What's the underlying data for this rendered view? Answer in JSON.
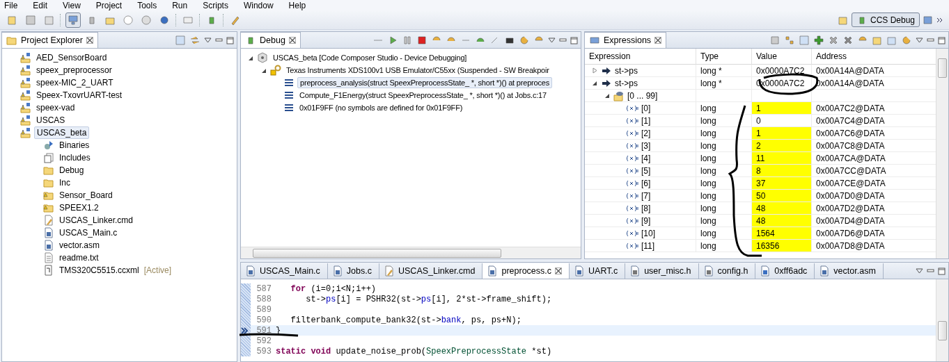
{
  "menu": [
    "File",
    "Edit",
    "View",
    "Project",
    "Tools",
    "Run",
    "Scripts",
    "Window",
    "Help"
  ],
  "perspective": {
    "label": "CCS Debug",
    "selected": true
  },
  "project_explorer": {
    "title": "Project Explorer",
    "items": [
      {
        "label": "AED_SensorBoard",
        "kind": "project",
        "selected": false
      },
      {
        "label": "speex_preprocessor",
        "kind": "project",
        "selected": false
      },
      {
        "label": "speex-MIC_2_UART",
        "kind": "project",
        "selected": false
      },
      {
        "label": "Speex-TxovrUART-test",
        "kind": "project",
        "selected": false
      },
      {
        "label": "speex-vad",
        "kind": "project",
        "selected": false
      },
      {
        "label": "USCAS",
        "kind": "project",
        "selected": false
      },
      {
        "label": "USCAS_beta",
        "kind": "project",
        "selected": true,
        "children": [
          {
            "label": "Binaries",
            "kind": "binaries",
            "selected": false
          },
          {
            "label": "Includes",
            "kind": "includes",
            "selected": false
          },
          {
            "label": "Debug",
            "kind": "folder",
            "selected": false
          },
          {
            "label": "Inc",
            "kind": "folder",
            "selected": false
          },
          {
            "label": "Sensor_Board",
            "kind": "folder-warning",
            "selected": false
          },
          {
            "label": "SPEEX1.2",
            "kind": "folder-warning",
            "selected": false
          },
          {
            "label": "USCAS_Linker.cmd",
            "kind": "linker",
            "selected": false
          },
          {
            "label": "USCAS_Main.c",
            "kind": "c-file",
            "selected": false
          },
          {
            "label": "vector.asm",
            "kind": "asm-file",
            "selected": false
          },
          {
            "label": "readme.txt",
            "kind": "text-file",
            "selected": false
          },
          {
            "label": "TMS320C5515.ccxml",
            "suffix": "[Active]",
            "kind": "ccxml",
            "selected": false
          }
        ]
      }
    ]
  },
  "debug": {
    "title": "Debug",
    "items": [
      {
        "label": "USCAS_beta [Code Composer Studio - Device Debugging]",
        "kind": "session",
        "expanded": true,
        "selected": false,
        "children": [
          {
            "label": "Texas Instruments XDS100v1 USB Emulator/C55xx (Suspended - SW Breakpoir",
            "kind": "target",
            "expanded": true,
            "selected": false,
            "children": [
              {
                "label": "preprocess_analysis(struct SpeexPreprocessState_ *, short *)() at preproces",
                "kind": "frame",
                "selected": true
              },
              {
                "label": "Compute_F1Energy(struct SpeexPreprocessState_ *, short *)() at Jobs.c:17",
                "kind": "frame",
                "selected": false
              },
              {
                "label": "0x01F9FF  (no symbols are defined for 0x01F9FF)",
                "kind": "frame",
                "selected": false
              }
            ]
          }
        ]
      }
    ]
  },
  "expressions": {
    "title": "Expressions",
    "columns": [
      "Expression",
      "Type",
      "Value",
      "Address"
    ],
    "rows": [
      {
        "expression": "st->ps",
        "kind": "pointer",
        "type": "long *",
        "value": "0x0000A7C2",
        "address": "0x00A14A@DATA",
        "expanded": false,
        "changed": false
      },
      {
        "expression": "st->ps",
        "kind": "pointer",
        "type": "long *",
        "value": "0x0000A7C2",
        "address": "0x00A14A@DATA",
        "expanded": true,
        "changed": false,
        "children": [
          {
            "expression": "[0 ... 99]",
            "kind": "range",
            "expanded": true,
            "changed": false,
            "children": [
              {
                "expression": "[0]",
                "kind": "variable",
                "type": "long",
                "value": "1",
                "address": "0x00A7C2@DATA",
                "changed": true
              },
              {
                "expression": "[1]",
                "kind": "variable",
                "type": "long",
                "value": "0",
                "address": "0x00A7C4@DATA",
                "changed": false
              },
              {
                "expression": "[2]",
                "kind": "variable",
                "type": "long",
                "value": "1",
                "address": "0x00A7C6@DATA",
                "changed": true
              },
              {
                "expression": "[3]",
                "kind": "variable",
                "type": "long",
                "value": "2",
                "address": "0x00A7C8@DATA",
                "changed": true
              },
              {
                "expression": "[4]",
                "kind": "variable",
                "type": "long",
                "value": "11",
                "address": "0x00A7CA@DATA",
                "changed": true
              },
              {
                "expression": "[5]",
                "kind": "variable",
                "type": "long",
                "value": "8",
                "address": "0x00A7CC@DATA",
                "changed": true
              },
              {
                "expression": "[6]",
                "kind": "variable",
                "type": "long",
                "value": "37",
                "address": "0x00A7CE@DATA",
                "changed": true
              },
              {
                "expression": "[7]",
                "kind": "variable",
                "type": "long",
                "value": "50",
                "address": "0x00A7D0@DATA",
                "changed": true
              },
              {
                "expression": "[8]",
                "kind": "variable",
                "type": "long",
                "value": "48",
                "address": "0x00A7D2@DATA",
                "changed": true
              },
              {
                "expression": "[9]",
                "kind": "variable",
                "type": "long",
                "value": "48",
                "address": "0x00A7D4@DATA",
                "changed": true
              },
              {
                "expression": "[10]",
                "kind": "variable",
                "type": "long",
                "value": "1564",
                "address": "0x00A7D6@DATA",
                "changed": true
              },
              {
                "expression": "[11]",
                "kind": "variable",
                "type": "long",
                "value": "16356",
                "address": "0x00A7D8@DATA",
                "changed": true
              }
            ]
          }
        ]
      }
    ]
  },
  "editor": {
    "tabs": [
      {
        "label": "USCAS_Main.c",
        "kind": "c-file",
        "selected": false
      },
      {
        "label": "Jobs.c",
        "kind": "c-file",
        "selected": false
      },
      {
        "label": "USCAS_Linker.cmd",
        "kind": "linker",
        "selected": false
      },
      {
        "label": "preprocess.c",
        "kind": "c-file",
        "selected": true
      },
      {
        "label": "UART.c",
        "kind": "c-file",
        "selected": false
      },
      {
        "label": "user_misc.h",
        "kind": "h-file",
        "selected": false
      },
      {
        "label": "config.h",
        "kind": "h-file",
        "selected": false
      },
      {
        "label": "0xff6adc",
        "kind": "disassembly",
        "selected": false
      },
      {
        "label": "vector.asm",
        "kind": "asm-file",
        "selected": false
      }
    ],
    "lines": [
      {
        "number": "587",
        "current": false,
        "tokens": [
          {
            "kind": "keyword",
            "text": "   for"
          },
          {
            "kind": "plain",
            "text": " (i=0;i<N;i++)"
          }
        ]
      },
      {
        "number": "588",
        "current": false,
        "tokens": [
          {
            "kind": "plain",
            "text": "      st->"
          },
          {
            "kind": "field",
            "text": "ps"
          },
          {
            "kind": "plain",
            "text": "[i] = PSHR32(st->"
          },
          {
            "kind": "field",
            "text": "ps"
          },
          {
            "kind": "plain",
            "text": "[i], 2*st->frame_shift);"
          }
        ]
      },
      {
        "number": "589",
        "current": false
      },
      {
        "number": "590",
        "current": false,
        "tokens": [
          {
            "kind": "plain",
            "text": "   filterbank_compute_bank32(st->"
          },
          {
            "kind": "field",
            "text": "bank"
          },
          {
            "kind": "plain",
            "text": ", ps, ps+N);"
          }
        ]
      },
      {
        "number": "591",
        "current": true,
        "tokens": [
          {
            "kind": "plain",
            "text": "}"
          }
        ]
      },
      {
        "number": "592",
        "current": false
      },
      {
        "number": "593",
        "current": false,
        "tokens": [
          {
            "kind": "keyword",
            "text": "static void"
          },
          {
            "kind": "plain",
            "text": " update_noise_prob("
          },
          {
            "kind": "type",
            "text": "SpeexPreprocessState"
          },
          {
            "kind": "plain",
            "text": " *st)"
          }
        ]
      }
    ]
  }
}
